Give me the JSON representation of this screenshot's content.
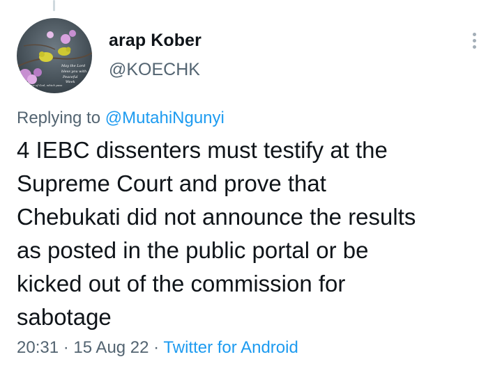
{
  "author": {
    "display_name": "arap Kober",
    "handle": "@KOECHK",
    "avatar_icon": "avatar-flowers-birds-icon"
  },
  "reply": {
    "prefix": "Replying to ",
    "mention": "@MutahiNgunyi"
  },
  "tweet": {
    "text": "4 IEBC dissenters must testify at the\nSupreme Court and prove that\nChebukati did not announce the results\nas posted in the public portal or be\nkicked out of the commission for\nsabotage"
  },
  "meta": {
    "time": "20:31",
    "separator1": " · ",
    "date": "15 Aug 22",
    "separator2": " · ",
    "source": "Twitter for Android"
  },
  "colors": {
    "accent": "#1d9bf0",
    "secondary_text": "#536471",
    "primary_text": "#0f1419"
  },
  "icons": {
    "more": "more-vertical-icon"
  }
}
